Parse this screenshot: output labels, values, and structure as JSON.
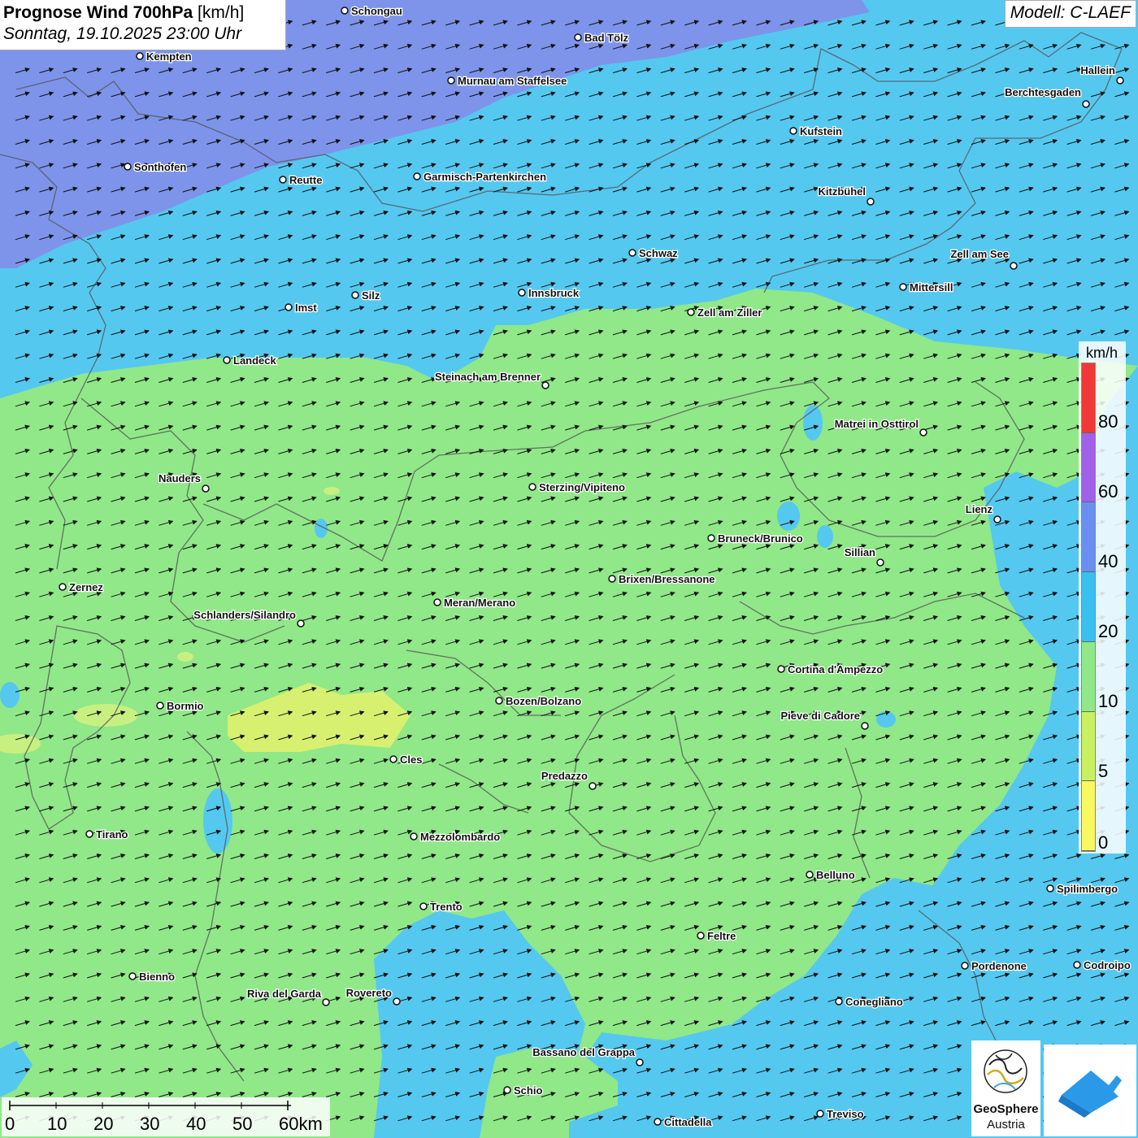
{
  "header": {
    "title_bold": "Prognose Wind 700hPa",
    "title_unit": "[km/h]",
    "datetime": "Sonntag, 19.10.2025 23:00 Uhr",
    "model": "Modell: C-LAEF"
  },
  "legend": {
    "unit": "km/h",
    "labels": [
      "80",
      "60",
      "40",
      "20",
      "10",
      "5",
      "0"
    ],
    "colors": [
      "#f03838",
      "#a060e8",
      "#6a8ff0",
      "#38c0f0",
      "#90e888",
      "#c8f060",
      "#f8f860"
    ]
  },
  "scale_bar": {
    "labels": [
      "0",
      "10",
      "20",
      "30",
      "40",
      "50",
      "60km"
    ]
  },
  "logos": {
    "geosphere_line1": "GeoSphere",
    "geosphere_line2": "Austria"
  },
  "wind": {
    "direction": "west-southwest to east-northeast",
    "zone_colors": {
      "strong": "#7d94ea",
      "medium": "#55c8f0",
      "weak": "#90e888",
      "calm": "#d8f070"
    }
  },
  "cities": [
    {
      "name": "Schongau"
    },
    {
      "name": "Bad Tölz"
    },
    {
      "name": "Kempten"
    },
    {
      "name": "Murnau am Staffelsee"
    },
    {
      "name": "Hallein"
    },
    {
      "name": "Berchtesgaden"
    },
    {
      "name": "Kufstein"
    },
    {
      "name": "Sonthofen"
    },
    {
      "name": "Reutte"
    },
    {
      "name": "Garmisch-Partenkirchen"
    },
    {
      "name": "Kitzbühel"
    },
    {
      "name": "Schwaz"
    },
    {
      "name": "Zell am See"
    },
    {
      "name": "Mittersill"
    },
    {
      "name": "Innsbruck"
    },
    {
      "name": "Silz"
    },
    {
      "name": "Imst"
    },
    {
      "name": "Zell am Ziller"
    },
    {
      "name": "Landeck"
    },
    {
      "name": "Steinach am Brenner"
    },
    {
      "name": "Matrei in Osttirol"
    },
    {
      "name": "Nauders"
    },
    {
      "name": "Sterzing/Vipiteno"
    },
    {
      "name": "Lienz"
    },
    {
      "name": "Bruneck/Brunico"
    },
    {
      "name": "Sillian"
    },
    {
      "name": "Brixen/Bressanone"
    },
    {
      "name": "Zernez"
    },
    {
      "name": "Meran/Merano"
    },
    {
      "name": "Schlanders/Silandro"
    },
    {
      "name": "Cortina d'Ampezzo"
    },
    {
      "name": "Bozen/Bolzano"
    },
    {
      "name": "Bormio"
    },
    {
      "name": "Pieve di Cadore"
    },
    {
      "name": "Cles"
    },
    {
      "name": "Predazzo"
    },
    {
      "name": "Tirano"
    },
    {
      "name": "Mezzolombardo"
    },
    {
      "name": "Belluno"
    },
    {
      "name": "Spilimbergo"
    },
    {
      "name": "Trento"
    },
    {
      "name": "Feltre"
    },
    {
      "name": "Pordenone"
    },
    {
      "name": "Codroipo"
    },
    {
      "name": "Bienno"
    },
    {
      "name": "Riva del Garda"
    },
    {
      "name": "Rovereto"
    },
    {
      "name": "Conegliano"
    },
    {
      "name": "Bassano del Grappa"
    },
    {
      "name": "Schio"
    },
    {
      "name": "Treviso"
    },
    {
      "name": "Cittadella"
    }
  ]
}
